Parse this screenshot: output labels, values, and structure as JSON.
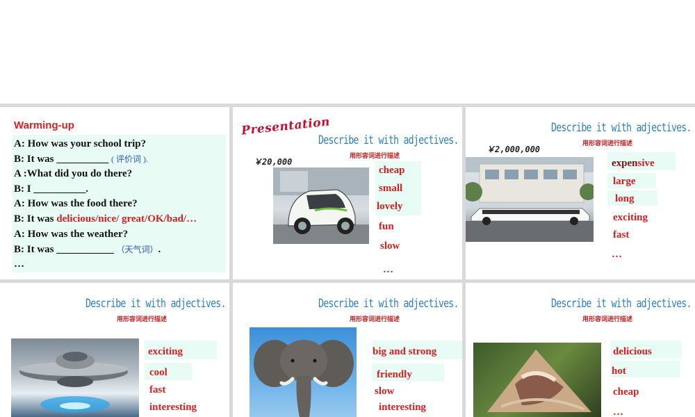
{
  "slide1": {
    "title": "Warming-up",
    "lines": [
      {
        "a": "A: How was your school trip?"
      },
      {
        "a": "B: It was __________ ",
        "b": "( 评价词 )."
      },
      {
        "a": "A :What did you do there?"
      },
      {
        "a": "B: I __________."
      },
      {
        "a": "A: How was the food there?"
      },
      {
        "a": "B: It was ",
        "r": "delicious/nice/ great/OK/bad/…"
      },
      {
        "a": "A: How was the weather?"
      },
      {
        "a": "B: It was ___________ ",
        "b": "（天气词）",
        "c": "."
      },
      {
        "a": "…"
      }
    ]
  },
  "common": {
    "heading": "Describe it with adjectives.",
    "subheading": "用形容词进行描述"
  },
  "slide2": {
    "presentation_label": "Presentation",
    "price": "￥20,000",
    "adjectives": [
      "cheap",
      "small",
      "lovely",
      "fun",
      "slow"
    ],
    "ellipsis": "…"
  },
  "slide3": {
    "price": "￥2,000,000",
    "adjective_first_prefix": "expen",
    "adjective_first_suffix": "sive",
    "adjectives": [
      "large",
      "long",
      "exciting",
      "fast"
    ],
    "ellipsis": "…"
  },
  "slide4": {
    "adjectives": [
      "exciting",
      "cool",
      "fast",
      "interesting"
    ]
  },
  "slide5": {
    "adjectives": [
      "big and strong",
      "friendly",
      "slow",
      "interesting"
    ]
  },
  "slide6": {
    "adjectives": [
      "delicious",
      "hot",
      "cheap"
    ],
    "ellipsis": "…"
  }
}
